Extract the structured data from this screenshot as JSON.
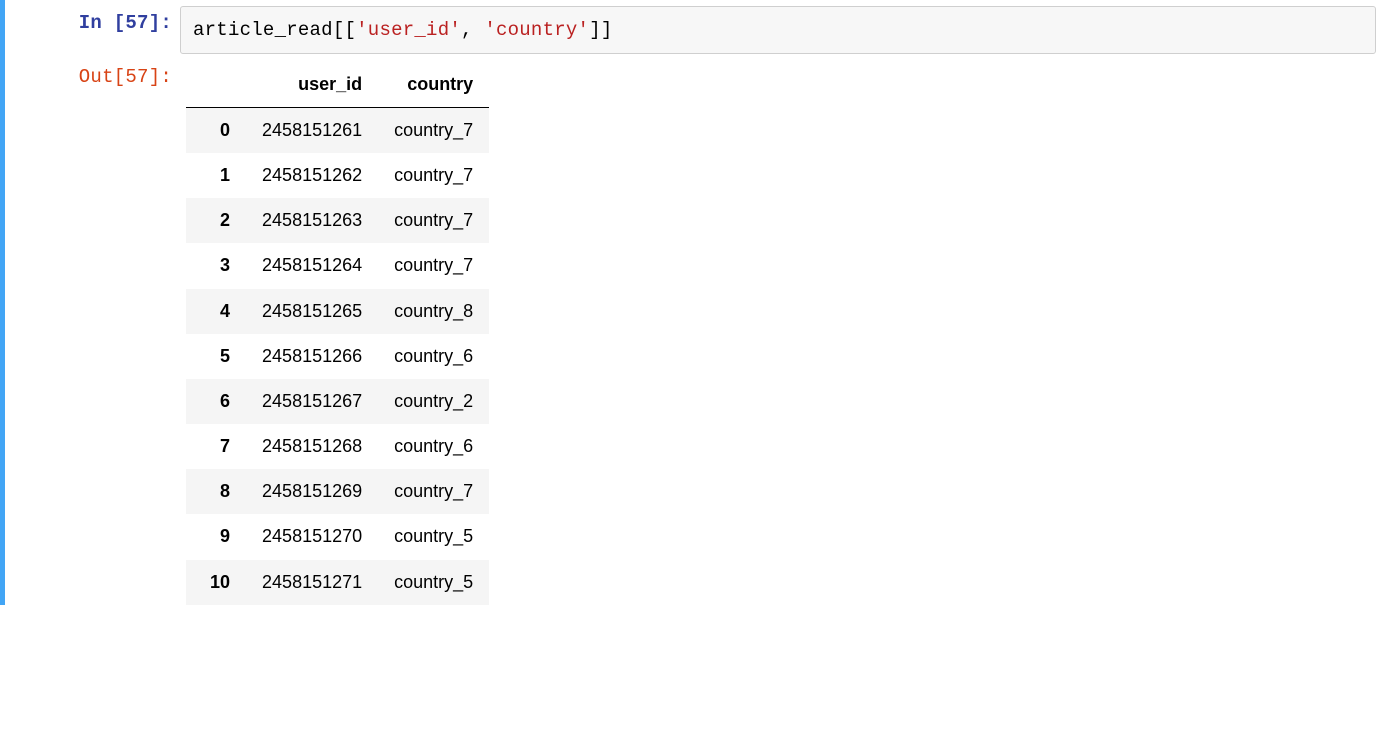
{
  "input": {
    "label": "In [57]:",
    "code_tokens": [
      {
        "class": "code-plain",
        "text": "article_read[["
      },
      {
        "class": "code-string",
        "text": "'user_id'"
      },
      {
        "class": "code-plain",
        "text": ", "
      },
      {
        "class": "code-string",
        "text": "'country'"
      },
      {
        "class": "code-plain",
        "text": "]]"
      }
    ]
  },
  "output": {
    "label": "Out[57]:",
    "table": {
      "columns": [
        "user_id",
        "country"
      ],
      "rows": [
        {
          "idx": "0",
          "user_id": "2458151261",
          "country": "country_7"
        },
        {
          "idx": "1",
          "user_id": "2458151262",
          "country": "country_7"
        },
        {
          "idx": "2",
          "user_id": "2458151263",
          "country": "country_7"
        },
        {
          "idx": "3",
          "user_id": "2458151264",
          "country": "country_7"
        },
        {
          "idx": "4",
          "user_id": "2458151265",
          "country": "country_8"
        },
        {
          "idx": "5",
          "user_id": "2458151266",
          "country": "country_6"
        },
        {
          "idx": "6",
          "user_id": "2458151267",
          "country": "country_2"
        },
        {
          "idx": "7",
          "user_id": "2458151268",
          "country": "country_6"
        },
        {
          "idx": "8",
          "user_id": "2458151269",
          "country": "country_7"
        },
        {
          "idx": "9",
          "user_id": "2458151270",
          "country": "country_5"
        },
        {
          "idx": "10",
          "user_id": "2458151271",
          "country": "country_5"
        }
      ]
    }
  }
}
